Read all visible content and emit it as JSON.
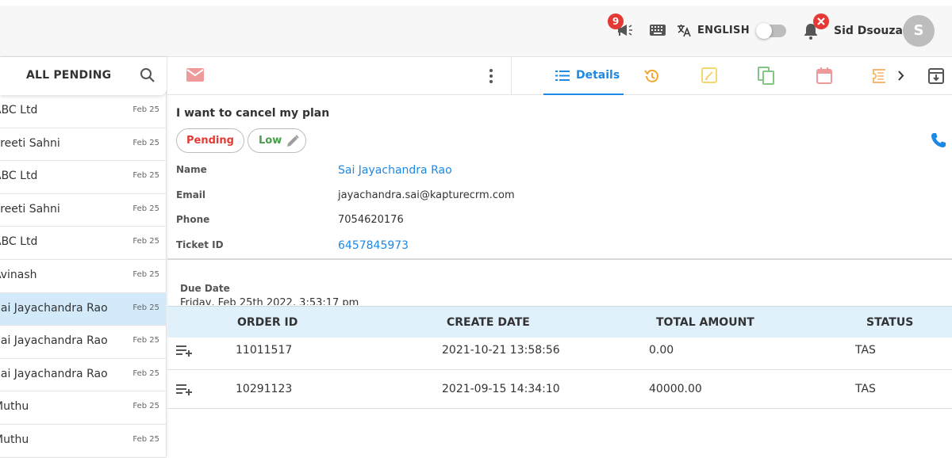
{
  "header": {
    "announcement_count": "9",
    "language": "ENGLISH",
    "user_name": "Sid Dsouza",
    "avatar_initial": "S"
  },
  "list": {
    "title": "ALL PENDING",
    "items": [
      {
        "name": "ABC Ltd",
        "date": "Feb 25",
        "selected": false
      },
      {
        "name": "Preeti Sahni",
        "date": "Feb 25",
        "selected": false
      },
      {
        "name": "ABC Ltd",
        "date": "Feb 25",
        "selected": false
      },
      {
        "name": "Preeti Sahni",
        "date": "Feb 25",
        "selected": false
      },
      {
        "name": "ABC Ltd",
        "date": "Feb 25",
        "selected": false
      },
      {
        "name": "Avinash",
        "date": "Feb 25",
        "selected": false
      },
      {
        "name": "Sai Jayachandra Rao",
        "date": "Feb 25",
        "selected": true
      },
      {
        "name": "Sai Jayachandra Rao",
        "date": "Feb 25",
        "selected": false
      },
      {
        "name": "Sai Jayachandra Rao",
        "date": "Feb 25",
        "selected": false
      },
      {
        "name": "Muthu",
        "date": "Feb 25",
        "selected": false
      },
      {
        "name": "Muthu",
        "date": "Feb 25",
        "selected": false
      }
    ]
  },
  "tabs": {
    "details_label": "Details"
  },
  "ticket": {
    "subject": "I want to cancel my plan",
    "status": "Pending",
    "priority": "Low",
    "fields": {
      "name_label": "Name",
      "name_value": "Sai Jayachandra Rao",
      "email_label": "Email",
      "email_value": "jayachandra.sai@kapturecrm.com",
      "phone_label": "Phone",
      "phone_value": "7054620176",
      "ticket_id_label": "Ticket ID",
      "ticket_id_value": "6457845973"
    },
    "due_date_label": "Due Date",
    "due_date_value": "Friday, Feb 25th 2022, 3:53:17 pm"
  },
  "orders": {
    "columns": [
      "ORDER ID",
      "CREATE DATE",
      "TOTAL AMOUNT",
      "STATUS"
    ],
    "rows": [
      {
        "order_id": "11011517",
        "create_date": "2021-10-21 13:58:56",
        "total_amount": "0.00",
        "status": "TAS"
      },
      {
        "order_id": "10291123",
        "create_date": "2021-09-15 14:34:10",
        "total_amount": "40000.00",
        "status": "TAS"
      }
    ]
  },
  "colors": {
    "accent_blue": "#1e88e5",
    "badge_red": "#e53935",
    "selected_row": "#d3eafb",
    "table_header": "#e1f1fc"
  },
  "icons": {
    "announcement": "megaphone-icon",
    "keyboard": "keyboard-icon",
    "language": "translate-icon",
    "notifications": "bell-icon",
    "search": "search-icon",
    "email": "mail-icon",
    "more": "more-vertical-icon",
    "details": "list-icon",
    "history": "history-icon",
    "notes": "note-edit-icon",
    "copy": "copy-icon",
    "calendar": "calendar-icon",
    "next": "chevron-right-icon",
    "archive": "archive-icon",
    "call": "phone-icon",
    "edit": "pencil-icon",
    "add_row": "playlist-add-icon"
  }
}
